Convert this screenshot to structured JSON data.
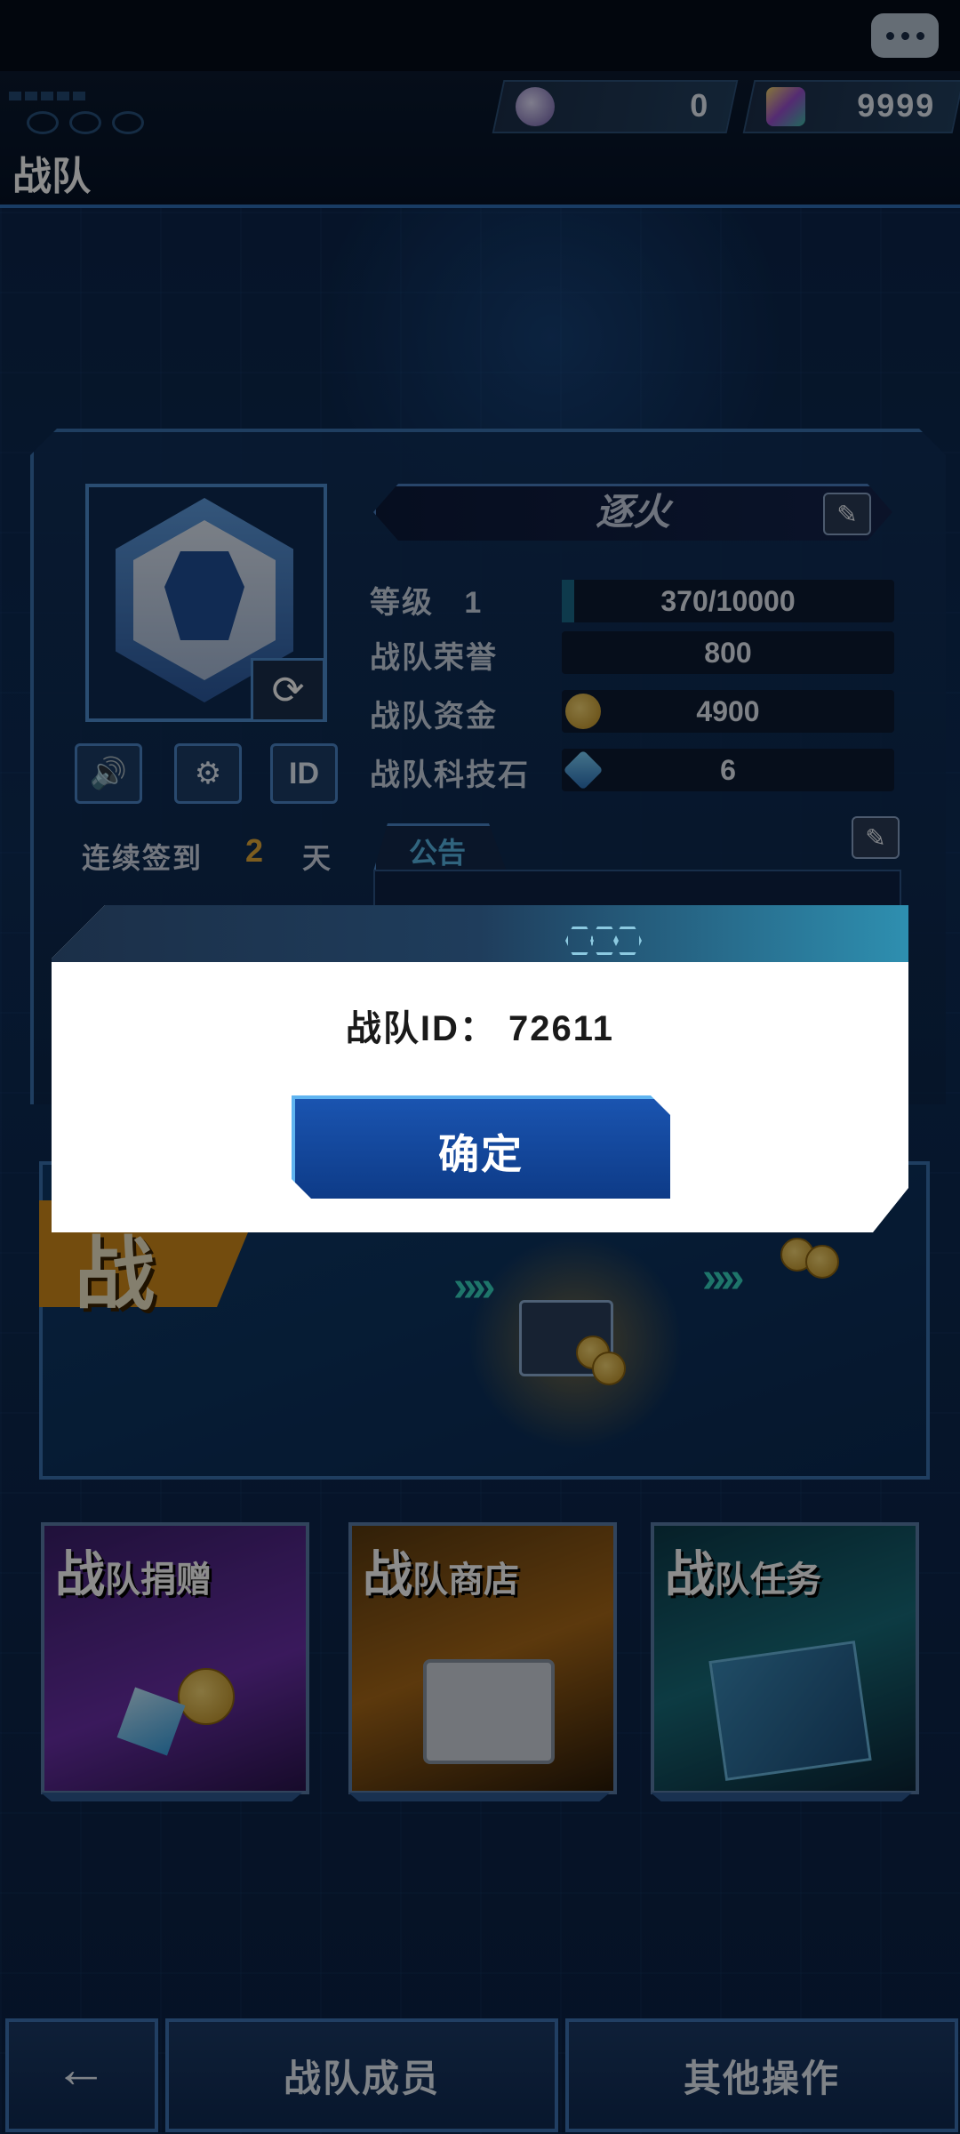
{
  "header": {
    "title": "战队",
    "currency_a": "0",
    "currency_b": "9999"
  },
  "team": {
    "name": "逐火",
    "level_label": "等级",
    "level": "1",
    "exp": "370/10000",
    "exp_progress": 0.037,
    "honor_label": "战队荣誉",
    "honor": "800",
    "funds_label": "战队资金",
    "funds": "4900",
    "tech_label": "战队科技石",
    "tech": "6",
    "id_button": "ID"
  },
  "signin": {
    "label": "连续签到",
    "days": "2",
    "unit": "天"
  },
  "notice": {
    "label": "公告"
  },
  "mission": {
    "partial_title": "战"
  },
  "cards": [
    {
      "title": "战",
      "sub": "队捐赠"
    },
    {
      "title": "战",
      "sub": "队商店"
    },
    {
      "title": "战",
      "sub": "队任务"
    }
  ],
  "nav": {
    "back_glyph": "←",
    "members": "战队成员",
    "other": "其他操作"
  },
  "dialog": {
    "text": "战队ID： 72611",
    "ok": "确定"
  },
  "colors": {
    "accent": "#3a72b0",
    "gold": "#e3a93a",
    "ok_button": "#1a54b0"
  }
}
